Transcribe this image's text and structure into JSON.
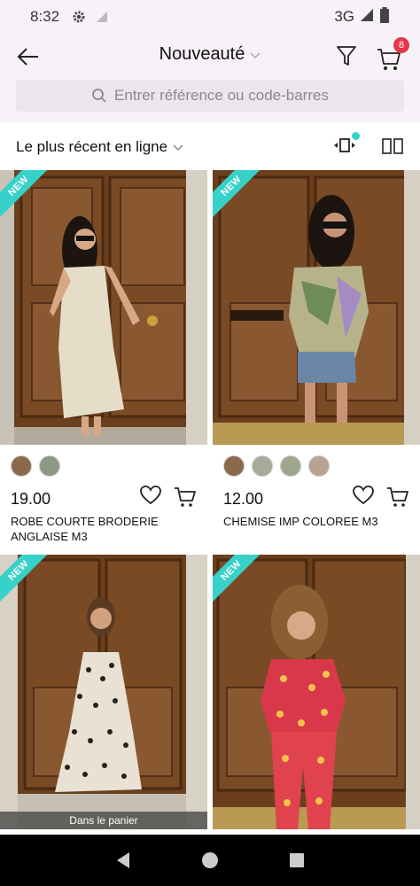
{
  "status": {
    "time": "8:32",
    "network": "3G"
  },
  "header": {
    "title": "Nouveauté",
    "cart_count": "8"
  },
  "search": {
    "placeholder": "Entrer référence ou code-barres"
  },
  "sort": {
    "label": "Le plus récent en ligne"
  },
  "badge_new": "NEW",
  "products": [
    {
      "price": "19.00",
      "name": "ROBE COURTE BRODERIE ANGLAISE M3",
      "swatches": 2
    },
    {
      "price": "12.00",
      "name": "CHEMISE IMP COLOREE M3",
      "swatches": 4
    },
    {
      "in_cart_label": "Dans le panier"
    },
    {}
  ],
  "colors": {
    "accent": "#36d2c9",
    "badge": "#e5374a",
    "header_bg": "#f7f2f7"
  },
  "icons": [
    "back-arrow-icon",
    "chevron-down-icon",
    "filter-icon",
    "cart-icon",
    "search-icon",
    "view-toggle-icon",
    "grid-icon",
    "heart-icon",
    "add-to-cart-icon"
  ]
}
